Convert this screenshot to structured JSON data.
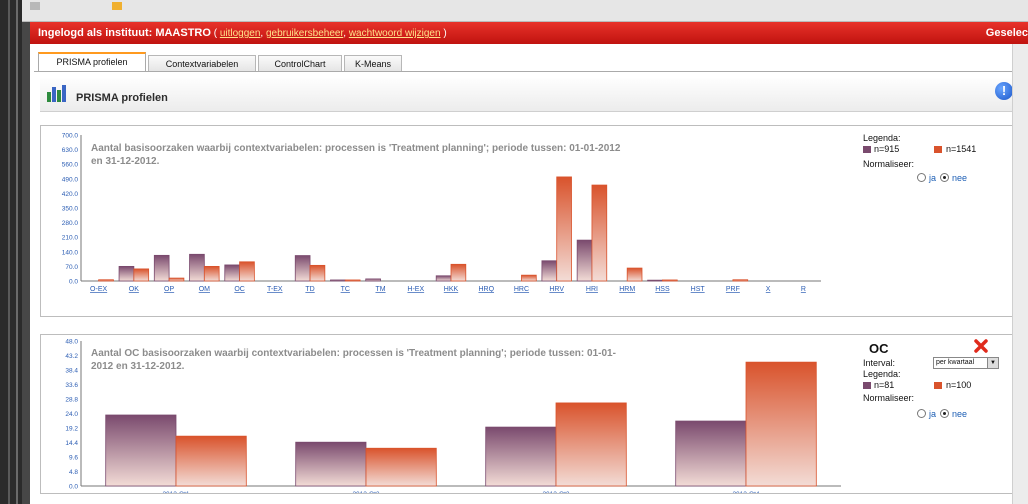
{
  "header": {
    "login_prefix": "Ingelogd als instituut: MAASTRO",
    "paren_open": " ( ",
    "logout": "uitloggen",
    "sep1": ", ",
    "user_mgmt": "gebruikersbeheer",
    "sep2": ", ",
    "change_password": "wachtwoord wijzigen",
    "paren_close": " )",
    "right_text": "Geselec"
  },
  "tabs": [
    {
      "label": "PRISMA profielen",
      "active": true
    },
    {
      "label": "Contextvariabelen",
      "active": false
    },
    {
      "label": "ControlChart",
      "active": false
    },
    {
      "label": "K-Means",
      "active": false
    }
  ],
  "page": {
    "title": "PRISMA profielen",
    "info_glyph": "!"
  },
  "chart_data": [
    {
      "type": "bar",
      "title": "Aantal basisoorzaken waarbij contextvariabelen: processen is 'Treatment planning'; periode tussen: 01-01-2012 en 31-12-2012.",
      "title_line1": "Aantal basisoorzaken waarbij contextvariabelen: processen is 'Treatment planning'; periode tussen: 01-01-2012",
      "title_line2": "en 31-12-2012.",
      "categories": [
        "O-EX",
        "OK",
        "OP",
        "OM",
        "OC",
        "T-EX",
        "TD",
        "TC",
        "TM",
        "H-EX",
        "HKK",
        "HRQ",
        "HRC",
        "HRV",
        "HRI",
        "HRM",
        "HSS",
        "HST",
        "PRF",
        "X",
        "R"
      ],
      "series": [
        {
          "name": "n=915",
          "color": "#7a4a6e",
          "values": [
            0,
            70,
            123,
            128,
            77,
            0,
            122,
            5,
            10,
            0,
            25,
            0,
            0,
            97,
            196,
            0,
            4,
            0,
            0,
            0,
            0
          ]
        },
        {
          "name": "n=1541",
          "color": "#d9532c",
          "values": [
            6,
            58,
            14,
            70,
            92,
            0,
            75,
            5,
            0,
            0,
            80,
            0,
            28,
            499,
            460,
            62,
            5,
            0,
            6,
            0,
            0
          ]
        }
      ],
      "yticks": [
        "700.0",
        "630.0",
        "560.0",
        "490.0",
        "420.0",
        "350.0",
        "280.0",
        "210.0",
        "140.0",
        "70.0",
        "0.0"
      ],
      "ylim": [
        0,
        700
      ],
      "legend_title": "Legenda:",
      "normalise_label": "Normaliseer:",
      "radio_yes": "ja",
      "radio_no": "nee",
      "normalise_selected": "nee"
    },
    {
      "type": "bar",
      "category_title": "OC",
      "title": "Aantal OC basisoorzaken waarbij contextvariabelen: processen is 'Treatment planning'; periode tussen: 01-01-2012 en 31-12-2012.",
      "title_line1": "Aantal OC basisoorzaken waarbij contextvariabelen: processen is 'Treatment planning'; periode tussen: 01-01-",
      "title_line2": "2012 en 31-12-2012.",
      "categories": [
        "2012-Qt1",
        "2012-Qt2",
        "2012-Qt3",
        "2012-Qt4"
      ],
      "series": [
        {
          "name": "n=81",
          "color": "#7a4a6e",
          "values": [
            23.5,
            14.5,
            19.5,
            21.5
          ]
        },
        {
          "name": "n=100",
          "color": "#d9532c",
          "values": [
            16.5,
            12.5,
            27.5,
            41
          ]
        }
      ],
      "yticks": [
        "48.0",
        "43.2",
        "38.4",
        "33.6",
        "28.8",
        "24.0",
        "19.2",
        "14.4",
        "9.6",
        "4.8",
        "0.0"
      ],
      "ylim": [
        0,
        48
      ],
      "interval_label": "Interval:",
      "interval_value": "per kwartaal",
      "legend_title": "Legenda:",
      "normalise_label": "Normaliseer:",
      "radio_yes": "ja",
      "radio_no": "nee",
      "normalise_selected": "nee"
    }
  ],
  "colors": {
    "series1": "#7a4a6e",
    "series2": "#d9532c",
    "header_red": "#d81e15",
    "tab_accent": "#ff9a1f",
    "close_red": "#e02a1c"
  },
  "icons": [
    "bar-chart-icon",
    "info-icon",
    "close-icon"
  ]
}
